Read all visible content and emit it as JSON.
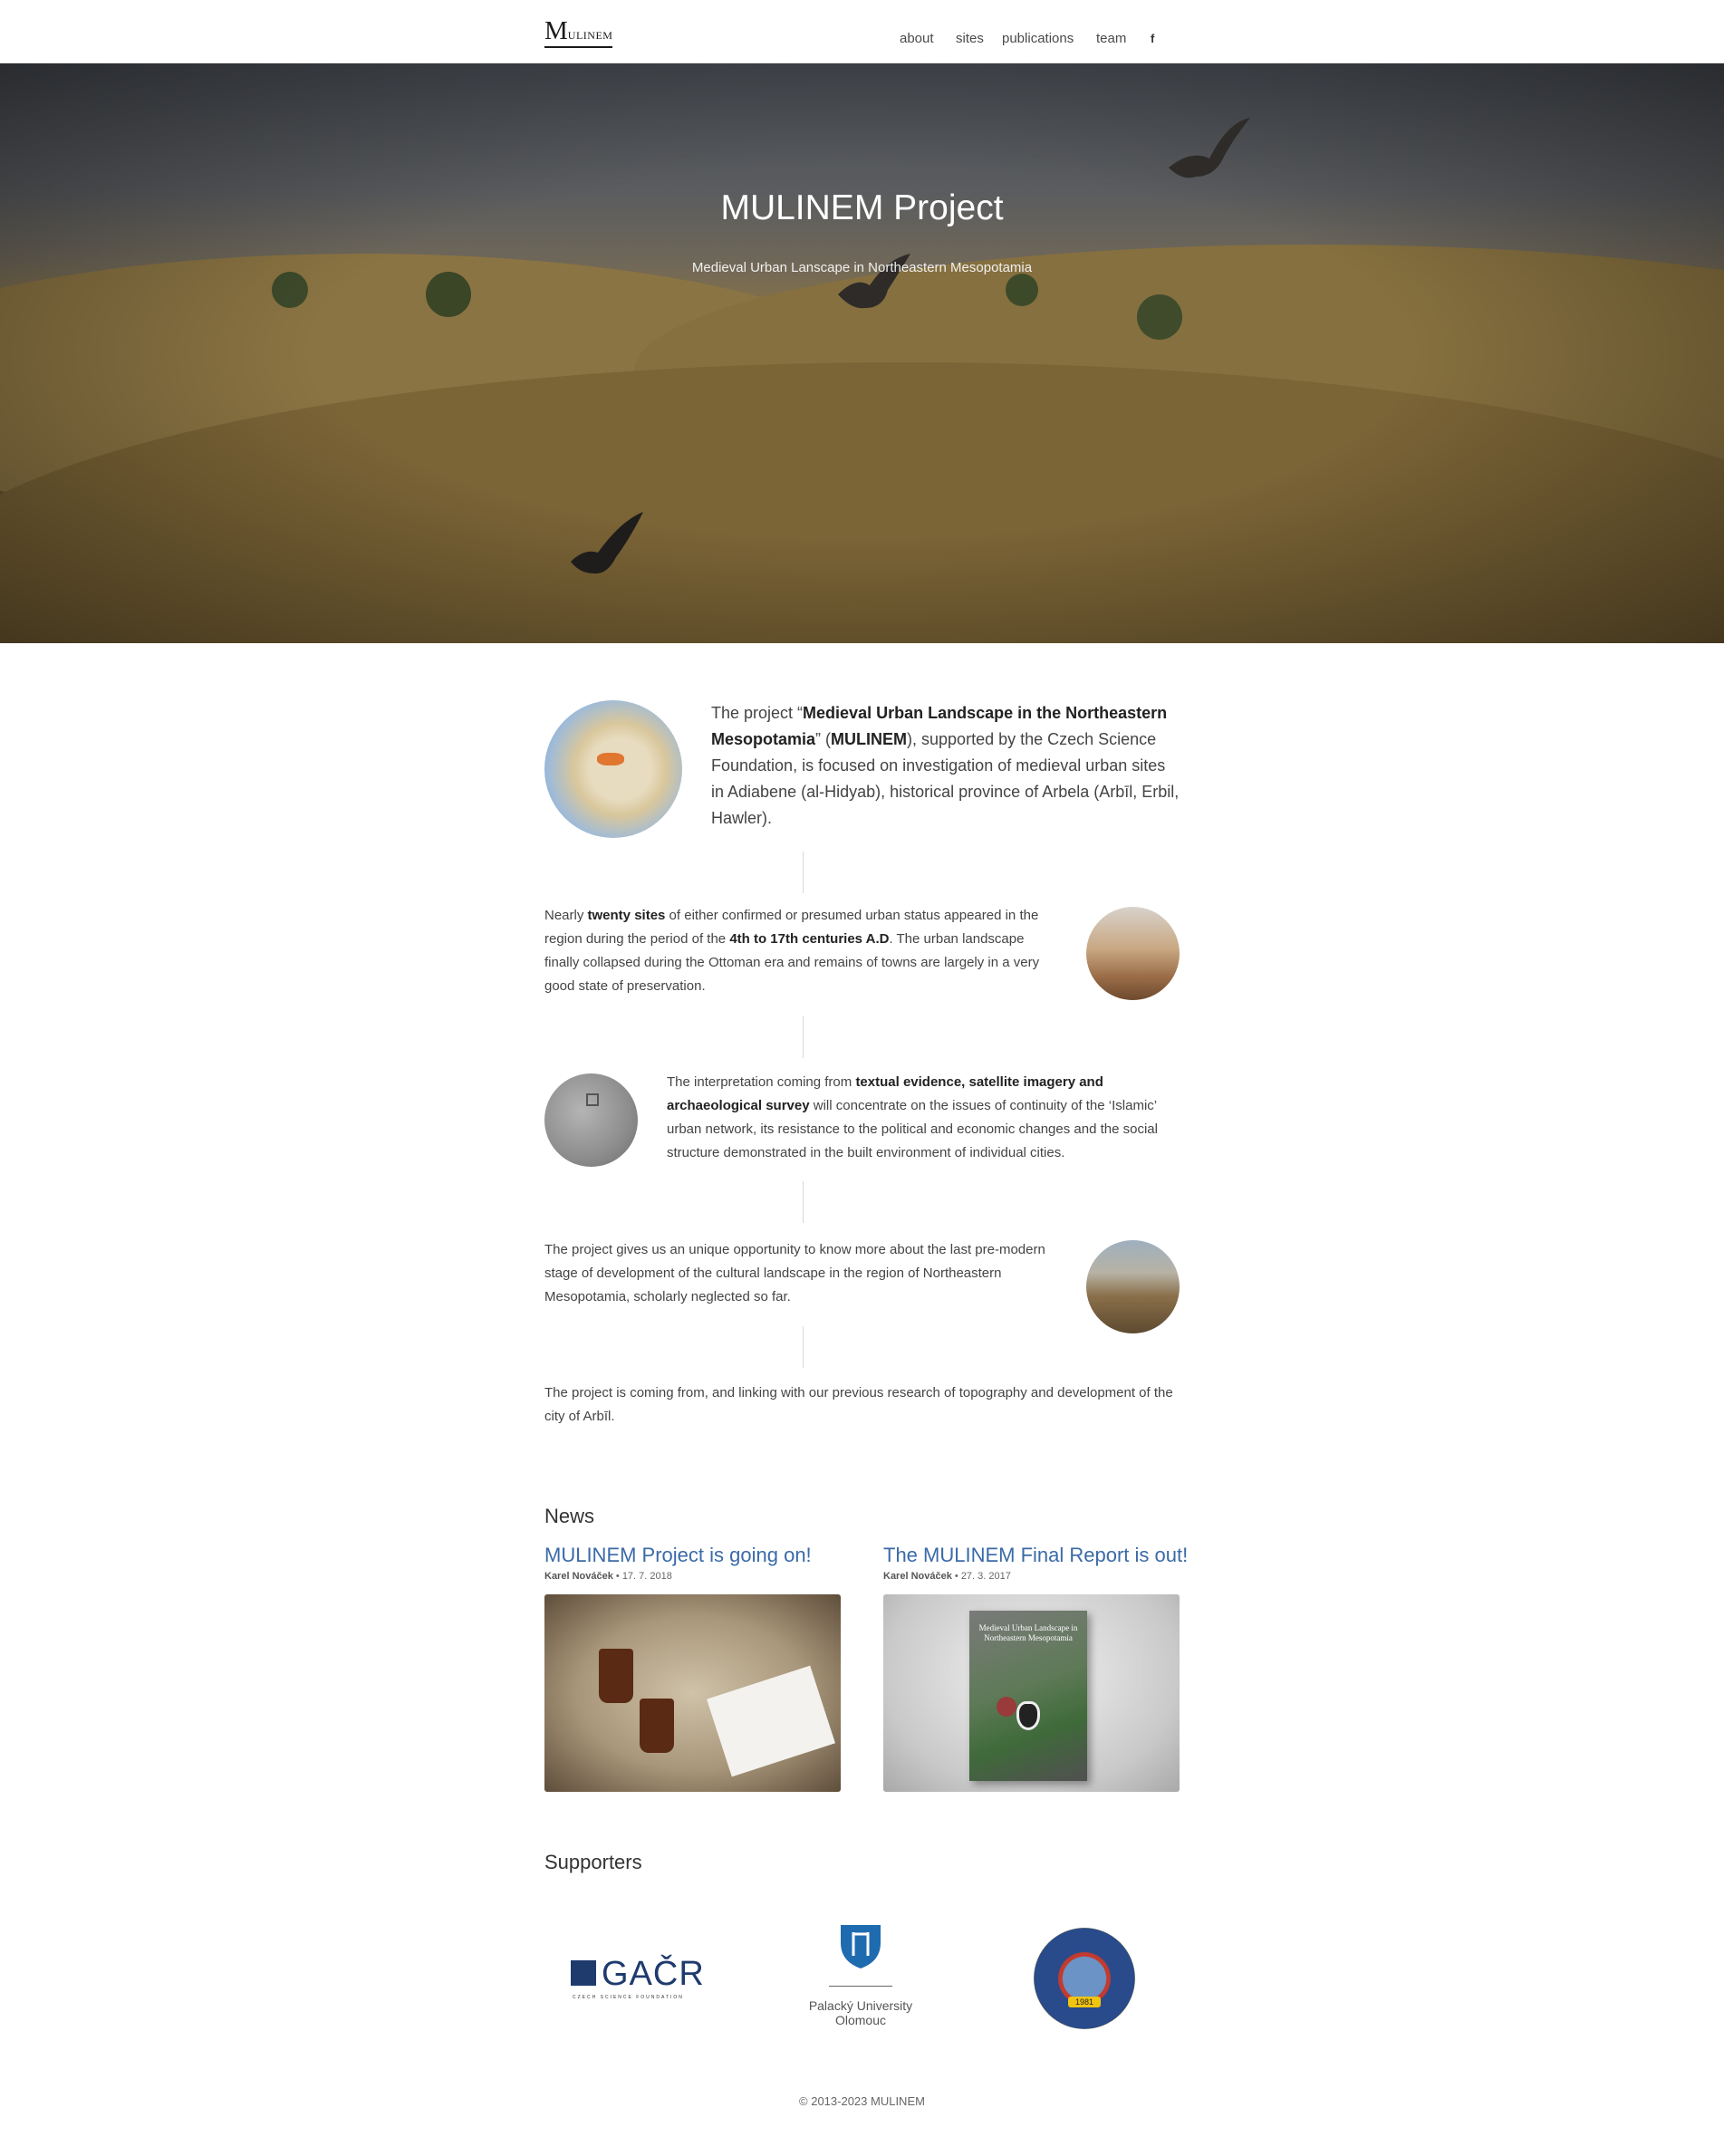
{
  "nav": {
    "logo_big": "M",
    "logo_small": "ULINEM",
    "links": [
      {
        "label": "about"
      },
      {
        "label": "sites"
      },
      {
        "label": "publications"
      },
      {
        "label": "team"
      }
    ],
    "facebook_icon": "f"
  },
  "hero": {
    "title": "MULINEM Project",
    "subtitle": "Medieval Urban Lanscape in Northeastern Mesopotamia"
  },
  "about": {
    "p1": {
      "pre": "The project “",
      "bold1": "Medieval Urban Landscape in the Northeastern Mesopotamia",
      "mid": "” (",
      "bold2": "MULINEM",
      "post": "), supported by the Czech Science Foundation, is focused on investigation of medieval urban sites in Adiabene (al-Hidyab), historical province of Arbela (Arbīl, Erbil, Hawler)."
    },
    "p2": {
      "pre": "Nearly ",
      "bold1": "twenty sites",
      "mid": " of either confirmed or presumed urban status appeared in the region during the period of the ",
      "bold2": "4th to 17th centuries A.D",
      "post": ". The urban landscape finally collapsed during the Ottoman era and remains of towns are largely in a very good state of preservation."
    },
    "p3": {
      "pre": "The interpretation coming from ",
      "bold1": "textual evidence, satellite imagery and archaeological survey",
      "post": " will concentrate on the issues of continuity of the ‘Islamic’ urban network, its resistance to the political and economic changes and the social structure demonstrated in the built environment of individual cities."
    },
    "p4": "The project gives us an unique opportunity to know more about the last pre-modern stage of development of the cultural landscape in the region of Northeastern Mesopotamia, scholarly neglected so far.",
    "p5": "The project is coming from, and linking with our previous research of topography and development of the city of Arbīl."
  },
  "news": {
    "heading": "News",
    "items": [
      {
        "title": "MULINEM Project is going on!",
        "author": "Karel Nováček",
        "date": "17. 7. 2018"
      },
      {
        "title": "The MULINEM Final Report is out!",
        "author": "Karel Nováček",
        "date": "27. 3. 2017"
      }
    ],
    "separator": "•",
    "book_cover_title": "Medieval Urban Landscape in Northeastern Mesopotamia"
  },
  "supporters": {
    "heading": "Supporters",
    "gacr": {
      "name": "GAČR",
      "sub": "CZECH SCIENCE FOUNDATION"
    },
    "palacky": {
      "line1": "Palacký University",
      "line2": "Olomouc"
    },
    "salahaddin": {
      "year": "1981"
    }
  },
  "footer": "© 2013-2023 MULINEM",
  "colors": {
    "news_link": "#3a6aa8",
    "accent_yellow": "#f1c40f"
  }
}
